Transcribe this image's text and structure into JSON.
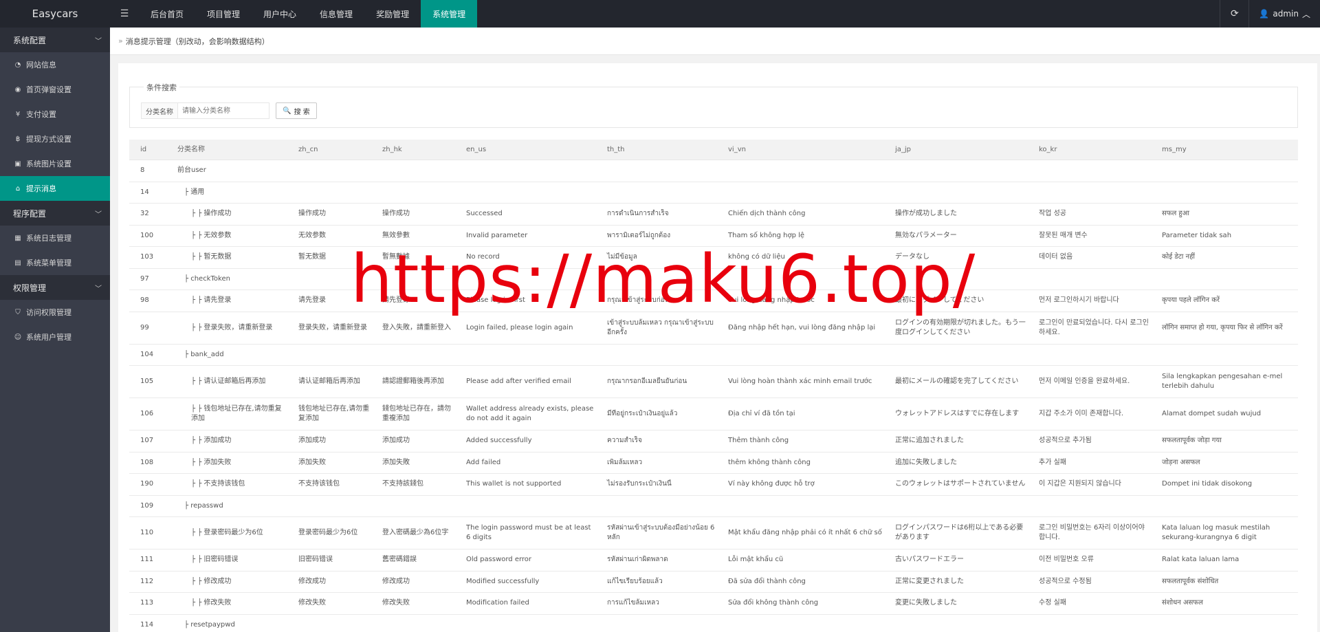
{
  "brand": "Easycars",
  "topnav": [
    "后台首页",
    "项目管理",
    "用户中心",
    "信息管理",
    "奖励管理",
    "系统管理"
  ],
  "user": "admin",
  "sidebar": {
    "groups": [
      {
        "label": "系统配置",
        "items": [
          {
            "label": "网站信息",
            "icon": "dashboard-icon"
          },
          {
            "label": "首页弹窗设置",
            "icon": "eye-icon"
          },
          {
            "label": "支付设置",
            "icon": "yen-icon"
          },
          {
            "label": "提现方式设置",
            "icon": "bitcoin-icon"
          },
          {
            "label": "系统图片设置",
            "icon": "image-icon"
          },
          {
            "label": "提示消息",
            "icon": "tag-icon",
            "active": true
          }
        ]
      },
      {
        "label": "程序配置",
        "items": [
          {
            "label": "系统日志管理",
            "icon": "calendar-icon"
          },
          {
            "label": "系统菜单管理",
            "icon": "table-icon"
          }
        ]
      },
      {
        "label": "权限管理",
        "items": [
          {
            "label": "访问权限管理",
            "icon": "shield-icon"
          },
          {
            "label": "系统用户管理",
            "icon": "user-icon"
          }
        ]
      }
    ]
  },
  "breadcrumb": "消息提示管理（别改动，会影响数据结构）",
  "search": {
    "legend": "条件搜索",
    "label": "分类名称",
    "placeholder": "请输入分类名称",
    "button": "搜 索"
  },
  "table": {
    "headers": [
      "id",
      "分类名称",
      "zh_cn",
      "zh_hk",
      "en_us",
      "th_th",
      "vi_vn",
      "ja_jp",
      "ko_kr",
      "ms_my"
    ],
    "rows": [
      {
        "id": "8",
        "name": "前台user",
        "level": 0,
        "zh_cn": "",
        "zh_hk": "",
        "en_us": "",
        "th_th": "",
        "vi_vn": "",
        "ja_jp": "",
        "ko_kr": "",
        "ms_my": ""
      },
      {
        "id": "14",
        "name": "├ 通用",
        "level": 1,
        "zh_cn": "",
        "zh_hk": "",
        "en_us": "",
        "th_th": "",
        "vi_vn": "",
        "ja_jp": "",
        "ko_kr": "",
        "ms_my": ""
      },
      {
        "id": "32",
        "name": "├ ├ 操作成功",
        "level": 2,
        "zh_cn": "操作成功",
        "zh_hk": "操作成功",
        "en_us": "Successed",
        "th_th": "การดำเนินการสำเร็จ",
        "vi_vn": "Chiến dịch thành công",
        "ja_jp": "操作が成功しました",
        "ko_kr": "작업 성공",
        "ms_my": "सफल हुआ"
      },
      {
        "id": "100",
        "name": "├ ├ 无效参数",
        "level": 2,
        "zh_cn": "无效参数",
        "zh_hk": "無效參數",
        "en_us": "Invalid parameter",
        "th_th": "พารามิเตอร์ไม่ถูกต้อง",
        "vi_vn": "Tham số không hợp lệ",
        "ja_jp": "無効なパラメーター",
        "ko_kr": "잘못된 매개 변수",
        "ms_my": "Parameter tidak sah"
      },
      {
        "id": "103",
        "name": "├ ├ 暂无数据",
        "level": 2,
        "zh_cn": "暂无数据",
        "zh_hk": "暫無數據",
        "en_us": "No record",
        "th_th": "ไม่มีข้อมูล",
        "vi_vn": "không có dữ liệu",
        "ja_jp": "データなし",
        "ko_kr": "데이터 없음",
        "ms_my": "कोई डेटा नहीं"
      },
      {
        "id": "97",
        "name": "├ checkToken",
        "level": 1,
        "zh_cn": "",
        "zh_hk": "",
        "en_us": "",
        "th_th": "",
        "vi_vn": "",
        "ja_jp": "",
        "ko_kr": "",
        "ms_my": ""
      },
      {
        "id": "98",
        "name": "├ ├ 请先登录",
        "level": 2,
        "zh_cn": "请先登录",
        "zh_hk": "請先登錄",
        "en_us": "Please log in first",
        "th_th": "กรุณาเข้าสู่ระบบก่อน",
        "vi_vn": "Vui lòng đăng nhập trước",
        "ja_jp": "最初にログインしてください",
        "ko_kr": "먼저 로그인하시기 바랍니다",
        "ms_my": "कृपया पहले लॉगिन करें"
      },
      {
        "id": "99",
        "name": "├ ├ 登录失败，请重新登录",
        "level": 2,
        "tall": true,
        "zh_cn": "登录失败，请重新登录",
        "zh_hk": "登入失敗，請重新登入",
        "en_us": "Login failed, please login again",
        "th_th": "เข้าสู่ระบบล้มเหลว กรุณาเข้าสู่ระบบอีกครั้ง",
        "vi_vn": "Đăng nhập hết hạn, vui lòng đăng nhập lại",
        "ja_jp": "ログインの有効期限が切れました。もう一度ログインしてください",
        "ko_kr": "로그인이 만료되었습니다. 다시 로그인하세요.",
        "ms_my": "लॉगिन समाप्त हो गया, कृपया फिर से लॉगिन करें"
      },
      {
        "id": "104",
        "name": "├ bank_add",
        "level": 1,
        "zh_cn": "",
        "zh_hk": "",
        "en_us": "",
        "th_th": "",
        "vi_vn": "",
        "ja_jp": "",
        "ko_kr": "",
        "ms_my": ""
      },
      {
        "id": "105",
        "name": "├ ├ 请认证邮箱后再添加",
        "level": 2,
        "tall": true,
        "zh_cn": "请认证邮箱后再添加",
        "zh_hk": "請認證郵箱後再添加",
        "en_us": "Please add after verified email",
        "th_th": "กรุณากรอกอีเมลยืนยันก่อน",
        "vi_vn": "Vui lòng hoàn thành xác minh email trước",
        "ja_jp": "最初にメールの確認を完了してください",
        "ko_kr": "먼저 이메일 인증을 완료하세요.",
        "ms_my": "Sila lengkapkan pengesahan e-mel terlebih dahulu"
      },
      {
        "id": "106",
        "name": "├ ├ 钱包地址已存在,请勿重复添加",
        "level": 2,
        "tall": true,
        "zh_cn": "钱包地址已存在,请勿重复添加",
        "zh_hk": "錢包地址已存在，請勿重複添加",
        "en_us": "Wallet address already exists, please do not add it again",
        "th_th": "มีที่อยู่กระเป๋าเงินอยู่แล้ว",
        "vi_vn": "Địa chỉ ví đã tồn tại",
        "ja_jp": "ウォレットアドレスはすでに存在します",
        "ko_kr": "지갑 주소가 이미 존재합니다.",
        "ms_my": "Alamat dompet sudah wujud"
      },
      {
        "id": "107",
        "name": "├ ├ 添加成功",
        "level": 2,
        "zh_cn": "添加成功",
        "zh_hk": "添加成功",
        "en_us": "Added successfully",
        "th_th": "ความสำเร็จ",
        "vi_vn": "Thêm thành công",
        "ja_jp": "正常に追加されました",
        "ko_kr": "성공적으로 추가됨",
        "ms_my": "सफलतापूर्वक जोड़ा गया"
      },
      {
        "id": "108",
        "name": "├ ├ 添加失败",
        "level": 2,
        "zh_cn": "添加失败",
        "zh_hk": "添加失敗",
        "en_us": "Add failed",
        "th_th": "เพิ่มล้มเหลว",
        "vi_vn": "thêm không thành công",
        "ja_jp": "追加に失敗しました",
        "ko_kr": "추가 실패",
        "ms_my": "जोड़ना असफल"
      },
      {
        "id": "190",
        "name": "├ ├ 不支持该钱包",
        "level": 2,
        "zh_cn": "不支持该钱包",
        "zh_hk": "不支持該錢包",
        "en_us": "This wallet is not supported",
        "th_th": "ไม่รองรับกระเป๋าเงินนี้",
        "vi_vn": "Ví này không được hỗ trợ",
        "ja_jp": "このウォレットはサポートされていません",
        "ko_kr": "이 지갑은 지원되지 않습니다",
        "ms_my": "Dompet ini tidak disokong"
      },
      {
        "id": "109",
        "name": "├ repasswd",
        "level": 1,
        "zh_cn": "",
        "zh_hk": "",
        "en_us": "",
        "th_th": "",
        "vi_vn": "",
        "ja_jp": "",
        "ko_kr": "",
        "ms_my": ""
      },
      {
        "id": "110",
        "name": "├ ├ 登录密码最少为6位",
        "level": 2,
        "tall": true,
        "zh_cn": "登录密码最少为6位",
        "zh_hk": "登入密碼最少為6位字",
        "en_us": "The login password must be at least 6 digits",
        "th_th": "รหัสผ่านเข้าสู่ระบบต้องมีอย่างน้อย 6 หลัก",
        "vi_vn": "Mật khẩu đăng nhập phải có ít nhất 6 chữ số",
        "ja_jp": "ログインパスワードは6桁以上である必要があります",
        "ko_kr": "로그인 비밀번호는 6자리 이상이어야 합니다.",
        "ms_my": "Kata laluan log masuk mestilah sekurang-kurangnya 6 digit"
      },
      {
        "id": "111",
        "name": "├ ├ 旧密码错误",
        "level": 2,
        "zh_cn": "旧密码错误",
        "zh_hk": "舊密碼錯誤",
        "en_us": "Old password error",
        "th_th": "รหัสผ่านเก่าผิดพลาด",
        "vi_vn": "Lỗi mật khẩu cũ",
        "ja_jp": "古いパスワードエラー",
        "ko_kr": "이전 비밀번호 오류",
        "ms_my": "Ralat kata laluan lama"
      },
      {
        "id": "112",
        "name": "├ ├ 修改成功",
        "level": 2,
        "zh_cn": "修改成功",
        "zh_hk": "修改成功",
        "en_us": "Modified successfully",
        "th_th": "แก้ไขเรียบร้อยแล้ว",
        "vi_vn": "Đã sửa đổi thành công",
        "ja_jp": "正常に変更されました",
        "ko_kr": "성공적으로 수정됨",
        "ms_my": "सफलतापूर्वक संशोधित"
      },
      {
        "id": "113",
        "name": "├ ├ 修改失败",
        "level": 2,
        "zh_cn": "修改失败",
        "zh_hk": "修改失败",
        "en_us": "Modification failed",
        "th_th": "การแก้ไขล้มเหลว",
        "vi_vn": "Sửa đổi không thành công",
        "ja_jp": "変更に失敗しました",
        "ko_kr": "수정 실패",
        "ms_my": "संशोधन असफल"
      },
      {
        "id": "114",
        "name": "├ resetpaypwd",
        "level": 1,
        "zh_cn": "",
        "zh_hk": "",
        "en_us": "",
        "th_th": "",
        "vi_vn": "",
        "ja_jp": "",
        "ko_kr": "",
        "ms_my": ""
      }
    ]
  },
  "watermark": "https://maku6.top/",
  "colors": {
    "accent": "#009688",
    "topbar": "#23262e",
    "sidebar": "#393d49",
    "watermark": "#e8000d"
  }
}
